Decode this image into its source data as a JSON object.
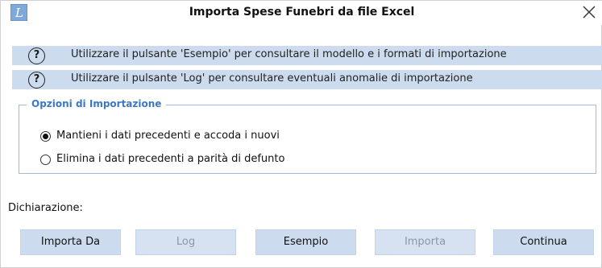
{
  "window": {
    "title": "Importa Spese Funebri da file Excel",
    "app_icon_letter": "L",
    "close_glyph": "close-icon"
  },
  "info": [
    {
      "icon": "question-circle-icon",
      "text": "Utilizzare il pulsante 'Esempio' per consultare il modello e i formati di importazione"
    },
    {
      "icon": "question-circle-icon",
      "text": "Utilizzare il pulsante 'Log' per consultare eventuali anomalie di importazione"
    }
  ],
  "options_group": {
    "legend": "Opzioni di Importazione",
    "options": [
      {
        "label": "Mantieni i dati precedenti e accoda i nuovi",
        "selected": true
      },
      {
        "label": "Elimina i dati precedenti a parità di defunto",
        "selected": false
      }
    ]
  },
  "declaration_label": "Dichiarazione:",
  "buttons": {
    "import_from": {
      "label": "Importa Da",
      "enabled": true
    },
    "log": {
      "label": "Log",
      "enabled": false
    },
    "example": {
      "label": "Esempio",
      "enabled": true
    },
    "import": {
      "label": "Importa",
      "enabled": false
    },
    "continue": {
      "label": "Continua",
      "enabled": true
    }
  },
  "colors": {
    "info_band": "#cddbee",
    "group_border": "#9ebbe0",
    "legend_text": "#3b78c4",
    "button_bg": "#cddbee",
    "disabled_text": "#8b97a8"
  }
}
